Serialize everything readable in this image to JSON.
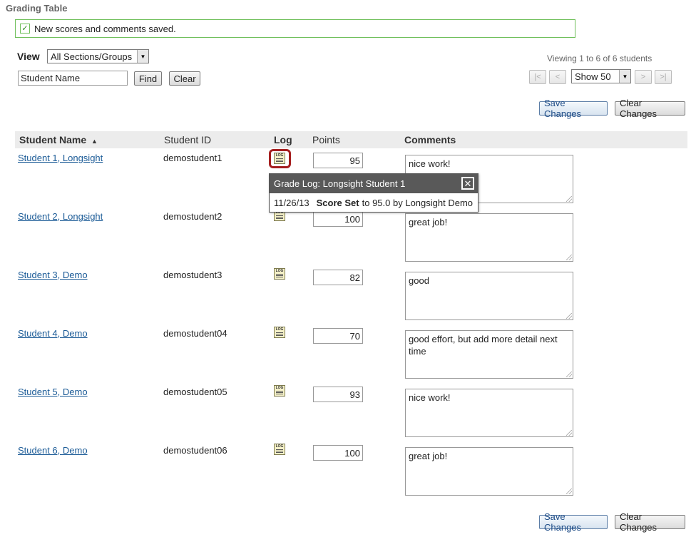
{
  "page_title": "Grading Table",
  "message": "New scores and comments saved.",
  "view_label": "View",
  "sections_select": "All Sections/Groups",
  "search": {
    "value": "Student Name",
    "find_label": "Find",
    "clear_label": "Clear"
  },
  "viewing_text": "Viewing 1 to 6 of 6 students",
  "pager": {
    "first": "|<",
    "prev": "<",
    "show": "Show 50",
    "next": ">",
    "last": ">|"
  },
  "actions": {
    "save_label": "Save Changes",
    "clear_label": "Clear Changes"
  },
  "headers": {
    "name": "Student Name",
    "sort_icon": "▲",
    "id": "Student ID",
    "log": "Log",
    "points": "Points",
    "comments": "Comments"
  },
  "students": [
    {
      "name": "Student 1, Longsight",
      "id": "demostudent1",
      "points": "95",
      "comment": "nice work!"
    },
    {
      "name": "Student 2, Longsight",
      "id": "demostudent2",
      "points": "100",
      "comment": "great job!"
    },
    {
      "name": "Student 3, Demo",
      "id": "demostudent3",
      "points": "82",
      "comment": "good"
    },
    {
      "name": "Student 4, Demo",
      "id": "demostudent04",
      "points": "70",
      "comment": "good effort, but add more detail next time"
    },
    {
      "name": "Student 5, Demo",
      "id": "demostudent05",
      "points": "93",
      "comment": "nice work!"
    },
    {
      "name": "Student 6, Demo",
      "id": "demostudent06",
      "points": "100",
      "comment": "great job!"
    }
  ],
  "log_icon_text": "LOG",
  "popup": {
    "title": "Grade Log: Longsight Student 1",
    "date": "11/26/13",
    "action": "Score Set",
    "detail": "to 95.0 by Longsight Demo"
  }
}
